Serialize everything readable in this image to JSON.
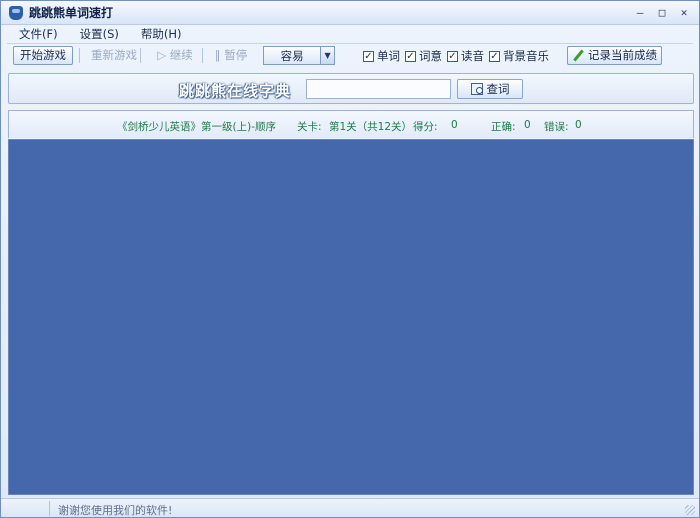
{
  "window": {
    "title": "跳跳熊单词速打",
    "controls": {
      "minimize": "–",
      "maximize": "□",
      "close": "✕"
    }
  },
  "menu": {
    "items": [
      {
        "label": "文件(F)"
      },
      {
        "label": "设置(S)"
      },
      {
        "label": "帮助(H)"
      }
    ]
  },
  "toolbar": {
    "start_label": "开始游戏",
    "restart_label": "重新游戏",
    "continue_label": "继续",
    "pause_label": "暂停",
    "difficulty_value": "容易",
    "checks": [
      {
        "label": "单词",
        "checked": true
      },
      {
        "label": "词意",
        "checked": true
      },
      {
        "label": "读音",
        "checked": true
      },
      {
        "label": "背景音乐",
        "checked": true
      }
    ],
    "record_label": "记录当前成绩"
  },
  "dictionary": {
    "title": "跳跳熊在线字典",
    "input_value": "",
    "query_label": "查词"
  },
  "status": {
    "book": "《剑桥少儿英语》第一级(上)-顺序",
    "level_label": "关卡:",
    "level_value": "第1关（共12关）",
    "score_label": "得分:",
    "score_value": "0",
    "correct_label": "正确:",
    "correct_value": "0",
    "wrong_label": "错误:",
    "wrong_value": "0"
  },
  "footer": {
    "message": "谢谢您使用我们的软件!"
  },
  "colors": {
    "game_area": "#4567ab",
    "status_text": "#1f7a4a"
  }
}
